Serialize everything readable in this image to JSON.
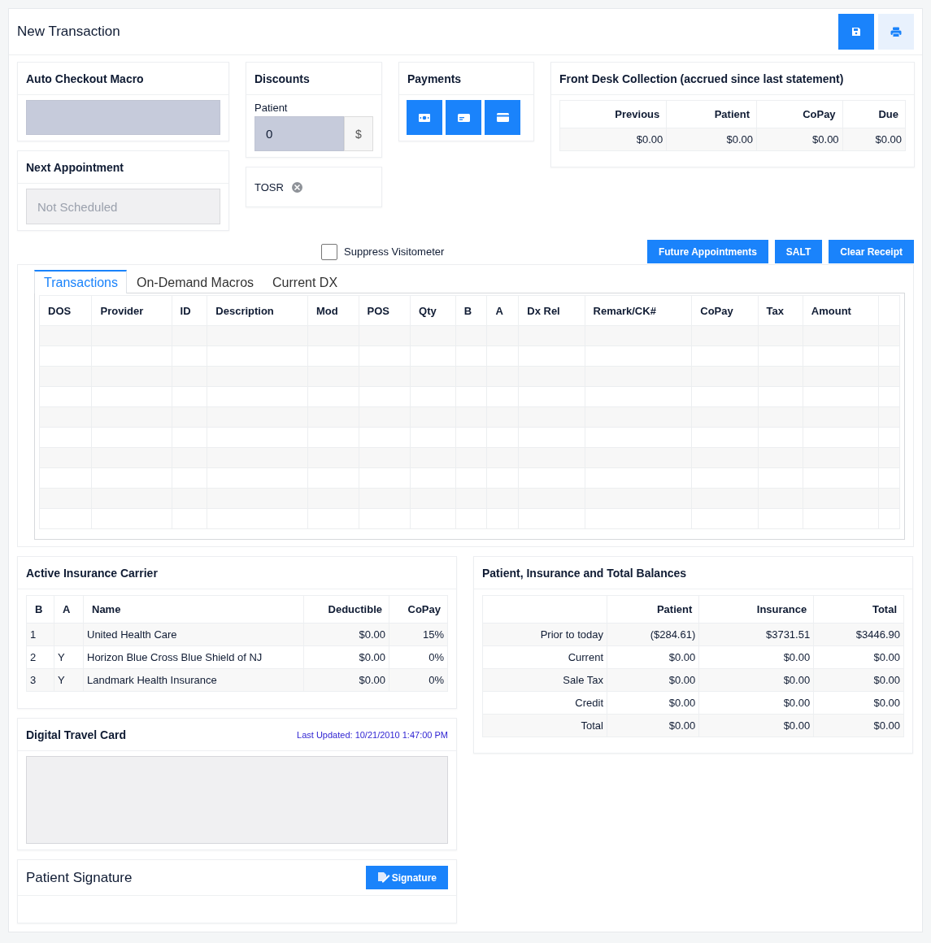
{
  "window": {
    "title": "New Transaction"
  },
  "toolbar": [
    {
      "kind": "save"
    },
    {
      "kind": "print"
    }
  ],
  "auto_checkout_macro": {
    "title": "Auto Checkout Macro"
  },
  "next_appointment": {
    "title": "Next Appointment",
    "value": "Not Scheduled"
  },
  "discounts": {
    "title": "Discounts",
    "label": "Patient",
    "value": "0",
    "unit": "$"
  },
  "tosr": {
    "label": "TOSR"
  },
  "payments": {
    "title": "Payments",
    "buttons": [
      {
        "kind": "cash"
      },
      {
        "kind": "card-front"
      },
      {
        "kind": "credit-card"
      }
    ]
  },
  "front_desk": {
    "title": "Front Desk Collection (accrued since last statement)",
    "columns": [
      "Previous",
      "Patient",
      "CoPay",
      "Due"
    ],
    "values": [
      "$0.00",
      "$0.00",
      "$0.00",
      "$0.00"
    ]
  },
  "suppress_visitometer": {
    "label": "Suppress Visitometer",
    "checked": false
  },
  "actions": [
    "Future Appointments",
    "SALT",
    "Clear Receipt"
  ],
  "tabs": [
    {
      "label": "Transactions",
      "selected": true
    },
    {
      "label": "On-Demand Macros",
      "selected": false
    },
    {
      "label": "Current DX",
      "selected": false
    }
  ],
  "transactions": {
    "columns": [
      "DOS",
      "Provider",
      "ID",
      "Description",
      "Mod",
      "POS",
      "Qty",
      "B",
      "A",
      "Dx Rel",
      "Remark/CK#",
      "CoPay",
      "Tax",
      "Amount"
    ]
  },
  "insurance": {
    "title": "Active Insurance Carrier",
    "columns": [
      "B",
      "A",
      "Name",
      "Deductible",
      "CoPay"
    ],
    "rows": [
      {
        "b": "1",
        "name": "United Health Care",
        "deductible": "$0.00",
        "copay": "15%"
      },
      {
        "b": "2",
        "a": "Y",
        "name": "Horizon Blue Cross Blue Shield of NJ",
        "deductible": "$0.00",
        "copay": "0%"
      },
      {
        "b": "3",
        "a": "Y",
        "name": "Landmark Health Insurance",
        "deductible": "$0.00",
        "copay": "0%"
      }
    ]
  },
  "travel_card": {
    "title": "Digital Travel Card",
    "updated": "Last Updated: 10/21/2010 1:47:00 PM"
  },
  "signature": {
    "title": "Patient Signature",
    "button": "Signature"
  },
  "balances": {
    "title": "Patient, Insurance and Total Balances",
    "columns": [
      "Patient",
      "Insurance",
      "Total"
    ],
    "rows": [
      {
        "label": "Prior to today",
        "values": [
          "($284.61)",
          "$3731.51",
          "$3446.90"
        ]
      },
      {
        "label": "Current",
        "values": [
          "$0.00",
          "$0.00",
          "$0.00"
        ]
      },
      {
        "label": "Sale Tax",
        "values": [
          "$0.00",
          "$0.00",
          "$0.00"
        ]
      },
      {
        "label": "Credit",
        "values": [
          "$0.00",
          "$0.00",
          "$0.00"
        ]
      },
      {
        "label": "Total",
        "values": [
          "$0.00",
          "$0.00",
          "$0.00"
        ]
      }
    ]
  }
}
